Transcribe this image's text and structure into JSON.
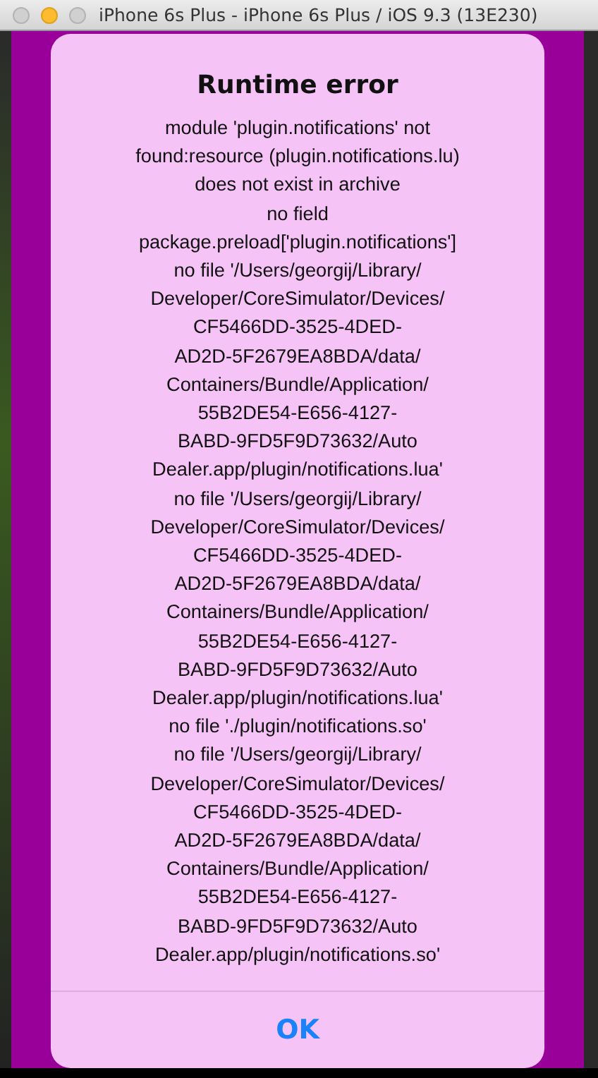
{
  "window": {
    "title": "iPhone 6s Plus - iPhone 6s Plus / iOS 9.3 (13E230)",
    "controls": [
      {
        "kind": "close",
        "active": false
      },
      {
        "kind": "minimize",
        "active": true
      },
      {
        "kind": "zoom",
        "active": false
      }
    ]
  },
  "alert": {
    "title": "Runtime error",
    "message_lines": [
      "module 'plugin.notifications' not",
      "found:resource (plugin.notifications.lu)",
      "does not exist in archive",
      "no field",
      "package.preload['plugin.notifications']",
      "no file '/Users/georgij/Library/",
      "Developer/CoreSimulator/Devices/",
      "CF5466DD-3525-4DED-",
      "AD2D-5F2679EA8BDA/data/",
      "Containers/Bundle/Application/",
      "55B2DE54-E656-4127-",
      "BABD-9FD5F9D73632/Auto",
      "Dealer.app/plugin/notifications.lua'",
      "no file '/Users/georgij/Library/",
      "Developer/CoreSimulator/Devices/",
      "CF5466DD-3525-4DED-",
      "AD2D-5F2679EA8BDA/data/",
      "Containers/Bundle/Application/",
      "55B2DE54-E656-4127-",
      "BABD-9FD5F9D73632/Auto",
      "Dealer.app/plugin/notifications.lua'",
      "no file './plugin/notifications.so'",
      "no file '/Users/georgij/Library/",
      "Developer/CoreSimulator/Devices/",
      "CF5466DD-3525-4DED-",
      "AD2D-5F2679EA8BDA/data/",
      "Containers/Bundle/Application/",
      "55B2DE54-E656-4127-",
      "BABD-9FD5F9D73632/Auto",
      "Dealer.app/plugin/notifications.so'"
    ],
    "buttons": [
      "OK"
    ]
  }
}
